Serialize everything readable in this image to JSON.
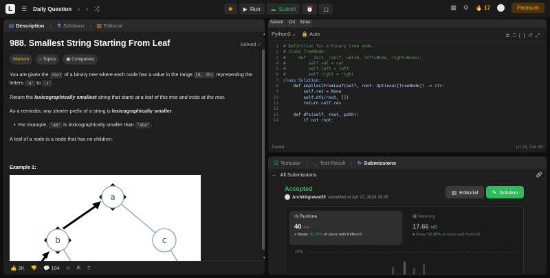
{
  "topbar": {
    "logo": "L",
    "list_label": "Daily Question",
    "run_label": "Run",
    "submit_label": "Submit",
    "streak": "17",
    "premium_label": "Premium"
  },
  "description": {
    "tabs": [
      "Description",
      "Solutions",
      "Editorial"
    ],
    "title": "988. Smallest String Starting From Leaf",
    "status": "Solved",
    "difficulty": "Medium",
    "chips": [
      "Topics",
      "Companies"
    ],
    "p1_a": "You are given the",
    "p1_code1": "root",
    "p1_b": "of a binary tree where each node has a value in the range",
    "p1_code2": "[0, 25]",
    "p1_c": "representing the letters",
    "p1_code3": "'a'",
    "p1_d": "to",
    "p1_code4": "'z'",
    "p1_e": ".",
    "p2_a": "Return the",
    "p2_b": "lexicographically smallest",
    "p2_c": "string that starts at a leaf of this tree and ends at the root.",
    "p3_a": "As a reminder, any shorter prefix of a string is",
    "p3_b": "lexicographically smaller",
    "p3_c": ".",
    "bullet_a": "For example,",
    "bullet_code1": "\"ab\"",
    "bullet_b": "is lexicographically smaller than",
    "bullet_code2": "\"aba\"",
    "bullet_c": ".",
    "p4": "A leaf of a node is a node that has no children.",
    "example_title": "Example 1:",
    "tree_nodes": [
      "a",
      "b",
      "c"
    ],
    "likes": "2K",
    "comments": "104"
  },
  "editor": {
    "tabs": [
      "Submit",
      "Ctrl",
      "Enter"
    ],
    "language": "Python3",
    "mode": "Auto",
    "lines": [
      "# Definition for a binary tree node.",
      "# class TreeNode:",
      "#     def __init__(self, val=0, left=None, right=None):",
      "#         self.val = val",
      "#         self.left = left",
      "#         self.right = right",
      "class Solution:",
      "    def smallestFromLeaf(self, root: Optional[TreeNode]) -> str:",
      "        self.res = None",
      "        self.dfs(root, [])",
      "        return self.res",
      "",
      "    def dfs(self, root, path):",
      "        if not root:"
    ],
    "status": "Saved",
    "position": "Ln 22, Col 25"
  },
  "results": {
    "tabs": [
      "Testcase",
      "Test Result",
      "Submissions"
    ],
    "back_label": "All Submissions",
    "verdict": "Accepted",
    "user": "ArchitAgrawal25",
    "submitted_text": "submitted at Apr 17, 2024 18:25",
    "editorial_label": "Editorial",
    "solution_label": "Solution",
    "runtime_label": "Runtime",
    "runtime_value": "40",
    "runtime_unit": "ms",
    "runtime_beats_pre": "Beats",
    "runtime_beats_pct": "70.25%",
    "runtime_beats_post": "of users with Python3",
    "memory_label": "Memory",
    "memory_value": "17.66",
    "memory_unit": "MB",
    "memory_beats_pre": "Beats",
    "memory_beats_pct": "58.36%",
    "memory_beats_post": "of users with Python3",
    "chart_tick": "10%"
  },
  "colors": {
    "accent_green": "#2cbb5d",
    "accent_orange": "#ffa116",
    "medium_yellow": "#ffb800"
  }
}
